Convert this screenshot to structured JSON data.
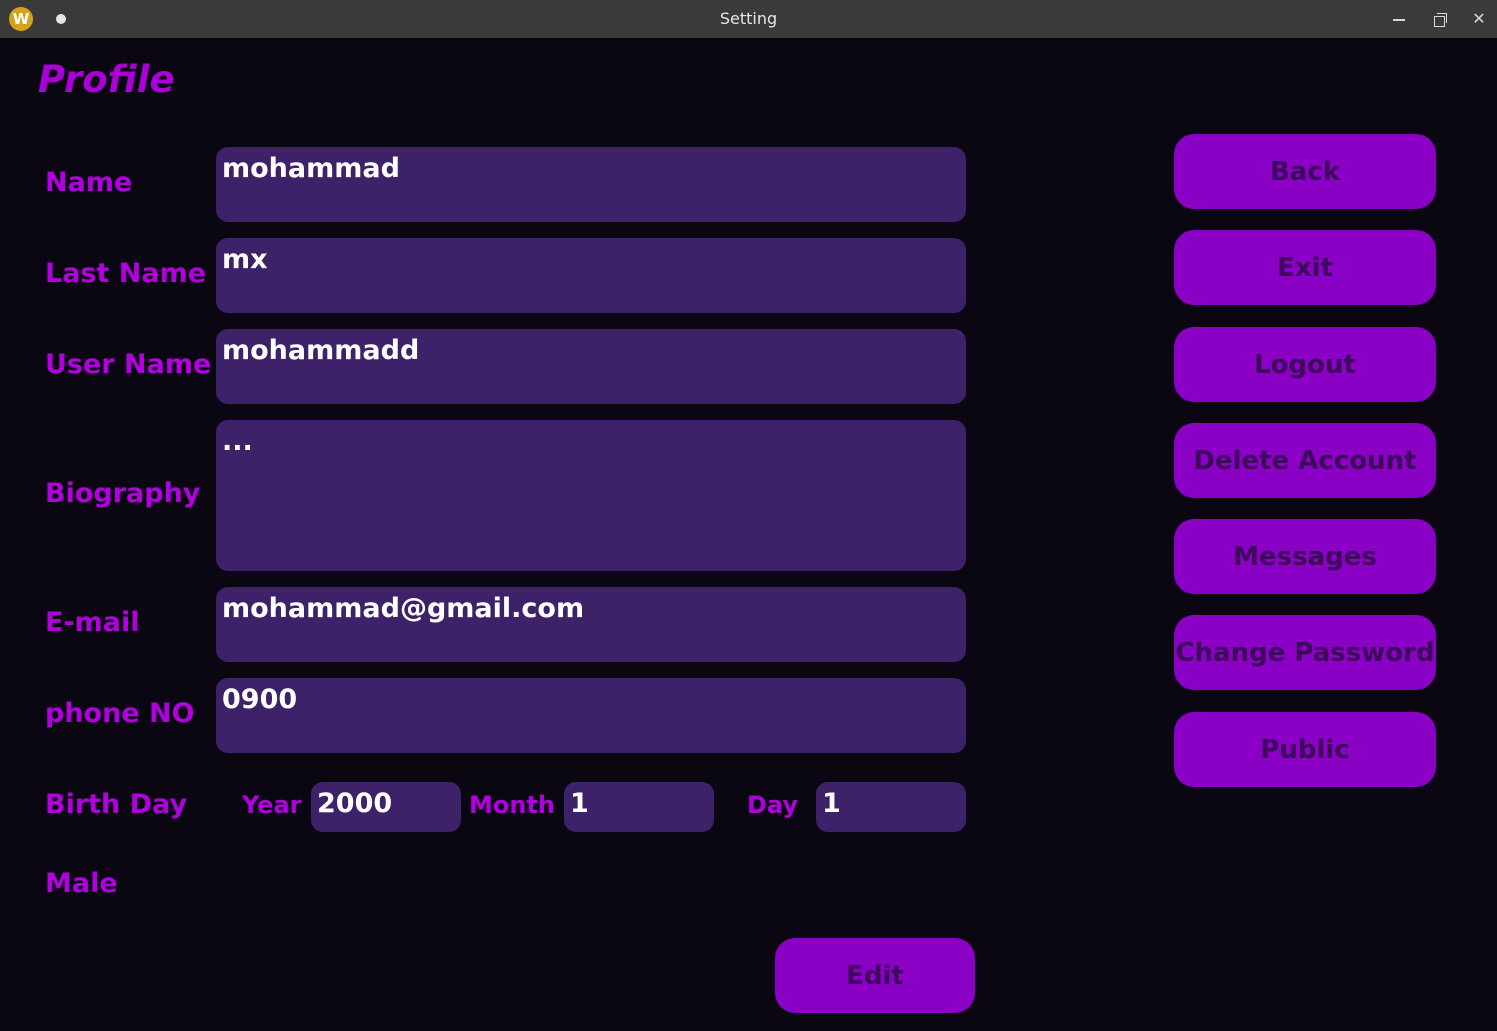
{
  "window": {
    "title": "Setting",
    "logo_letter": "W"
  },
  "page": {
    "title": "Profile"
  },
  "form": {
    "name_label": "Name",
    "name_value": "mohammad",
    "last_name_label": "Last Name",
    "last_name_value": "mx",
    "user_name_label": "User Name",
    "user_name_value": "mohammadd",
    "biography_label": "Biography",
    "biography_value": "...",
    "email_label": "E-mail",
    "email_value": "mohammad@gmail.com",
    "phone_label": "phone NO",
    "phone_value": "0900",
    "birthday_label": "Birth Day",
    "year_label": "Year",
    "year_value": "2000",
    "month_label": "Month",
    "month_value": "1",
    "day_label": "Day",
    "day_value": "1",
    "gender_label": "Male"
  },
  "buttons": {
    "back": "Back",
    "exit": "Exit",
    "logout": "Logout",
    "delete_account": "Delete Account",
    "messages": "Messages",
    "change_password": "Change Password",
    "public": "Public",
    "edit": "Edit"
  },
  "colors": {
    "background": "#0a0713",
    "accent": "#8a00c4",
    "label": "#b000dd",
    "field": "#3d2169"
  }
}
